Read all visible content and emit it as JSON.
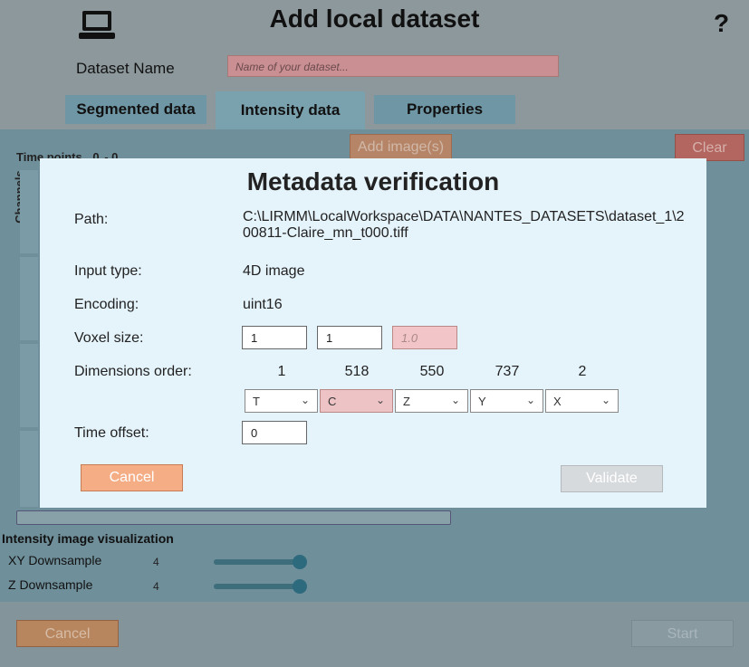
{
  "app": {
    "title": "Add local dataset",
    "help_label": "?",
    "dataset_name_label": "Dataset Name",
    "dataset_name_placeholder": "Name of your dataset...",
    "tabs": [
      {
        "label": "Segmented data",
        "active": false
      },
      {
        "label": "Intensity data",
        "active": true
      },
      {
        "label": "Properties",
        "active": false
      }
    ],
    "add_images_label": "Add image(s)",
    "clear_label": "Clear",
    "time_points_label": "Time points",
    "time_points_from": "0",
    "time_points_to": "0",
    "channels_label": "Channels",
    "visualization_title": "Intensity image visualization",
    "xy_downsample_label": "XY Downsample",
    "xy_downsample_value": "4",
    "z_downsample_label": "Z Downsample",
    "z_downsample_value": "4",
    "cancel_label": "Cancel",
    "start_label": "Start"
  },
  "modal": {
    "title": "Metadata verification",
    "path_label": "Path:",
    "path_value": "C:\\LIRMM\\LocalWorkspace\\DATA\\NANTES_DATASETS\\dataset_1\\200811-Claire_mn_t000.tiff",
    "input_type_label": "Input type:",
    "input_type_value": "4D image",
    "encoding_label": "Encoding:",
    "encoding_value": "uint16",
    "voxel_size_label": "Voxel size:",
    "voxel_x": "1",
    "voxel_y": "1",
    "voxel_z_placeholder": "1.0",
    "dimensions_order_label": "Dimensions order:",
    "dimension_sizes": [
      "1",
      "518",
      "550",
      "737",
      "2"
    ],
    "dimension_axes": [
      "T",
      "C",
      "Z",
      "Y",
      "X"
    ],
    "time_offset_label": "Time offset:",
    "time_offset_value": "0",
    "cancel_label": "Cancel",
    "validate_label": "Validate"
  },
  "colors": {
    "modal_bg": "#e5f3fb",
    "cancel_orange": "#f4ad85",
    "error_pink": "#f2c6c8"
  }
}
